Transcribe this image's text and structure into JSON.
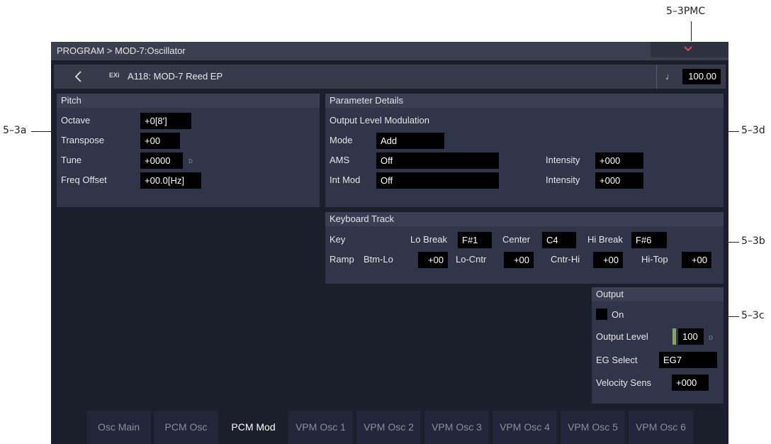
{
  "callouts": {
    "pmc": "5–3PMC",
    "a": "5–3a",
    "d": "5–3d",
    "b": "5–3b",
    "c": "5–3c"
  },
  "titlebar": {
    "title": "PROGRAM > MOD-7:Oscillator"
  },
  "program": {
    "type_badge": "EXi",
    "name": "A118: MOD-7 Reed EP",
    "tempo_icon": "♩",
    "tempo": "100.00"
  },
  "pitch": {
    "header": "Pitch",
    "octave_label": "Octave",
    "octave_value": "+0[8']",
    "transpose_label": "Transpose",
    "transpose_value": "+00",
    "tune_label": "Tune",
    "tune_value": "+0000",
    "tune_d": "D",
    "freq_label": "Freq Offset",
    "freq_value": "+00.0[Hz]"
  },
  "details": {
    "header": "Parameter Details",
    "section": "Output Level Modulation",
    "mode_label": "Mode",
    "mode_value": "Add",
    "ams_label": "AMS",
    "ams_value": "Off",
    "ams_int_label": "Intensity",
    "ams_int_value": "+000",
    "intmod_label": "Int Mod",
    "intmod_value": "Off",
    "intmod_int_label": "Intensity",
    "intmod_int_value": "+000"
  },
  "keytrack": {
    "header": "Keyboard Track",
    "key_label": "Key",
    "lobreak_label": "Lo Break",
    "lobreak_value": "F#1",
    "center_label": "Center",
    "center_value": "C4",
    "hibreak_label": "Hi Break",
    "hibreak_value": "F#6",
    "ramp_label": "Ramp",
    "btmlo_label": "Btm-Lo",
    "btmlo_value": "+00",
    "locntr_label": "Lo-Cntr",
    "locntr_value": "+00",
    "cntrhi_label": "Cntr-Hi",
    "cntrhi_value": "+00",
    "hitop_label": "Hi-Top",
    "hitop_value": "+00"
  },
  "output": {
    "header": "Output",
    "on_label": "On",
    "level_label": "Output Level",
    "level_value": "100",
    "level_d": "D",
    "eg_label": "EG Select",
    "eg_value": "EG7",
    "vel_label": "Velocity Sens",
    "vel_value": "+000"
  },
  "tabs": [
    "Osc Main",
    "PCM Osc",
    "PCM Mod",
    "VPM Osc 1",
    "VPM Osc 2",
    "VPM Osc 3",
    "VPM Osc 4",
    "VPM Osc 5",
    "VPM Osc 6"
  ],
  "active_tab": "PCM Mod",
  "colors": {
    "background": "#1b1e2b",
    "panel": "#30354a",
    "level_accent": "#8aa84a",
    "menu_chevron": "#e0455a"
  }
}
